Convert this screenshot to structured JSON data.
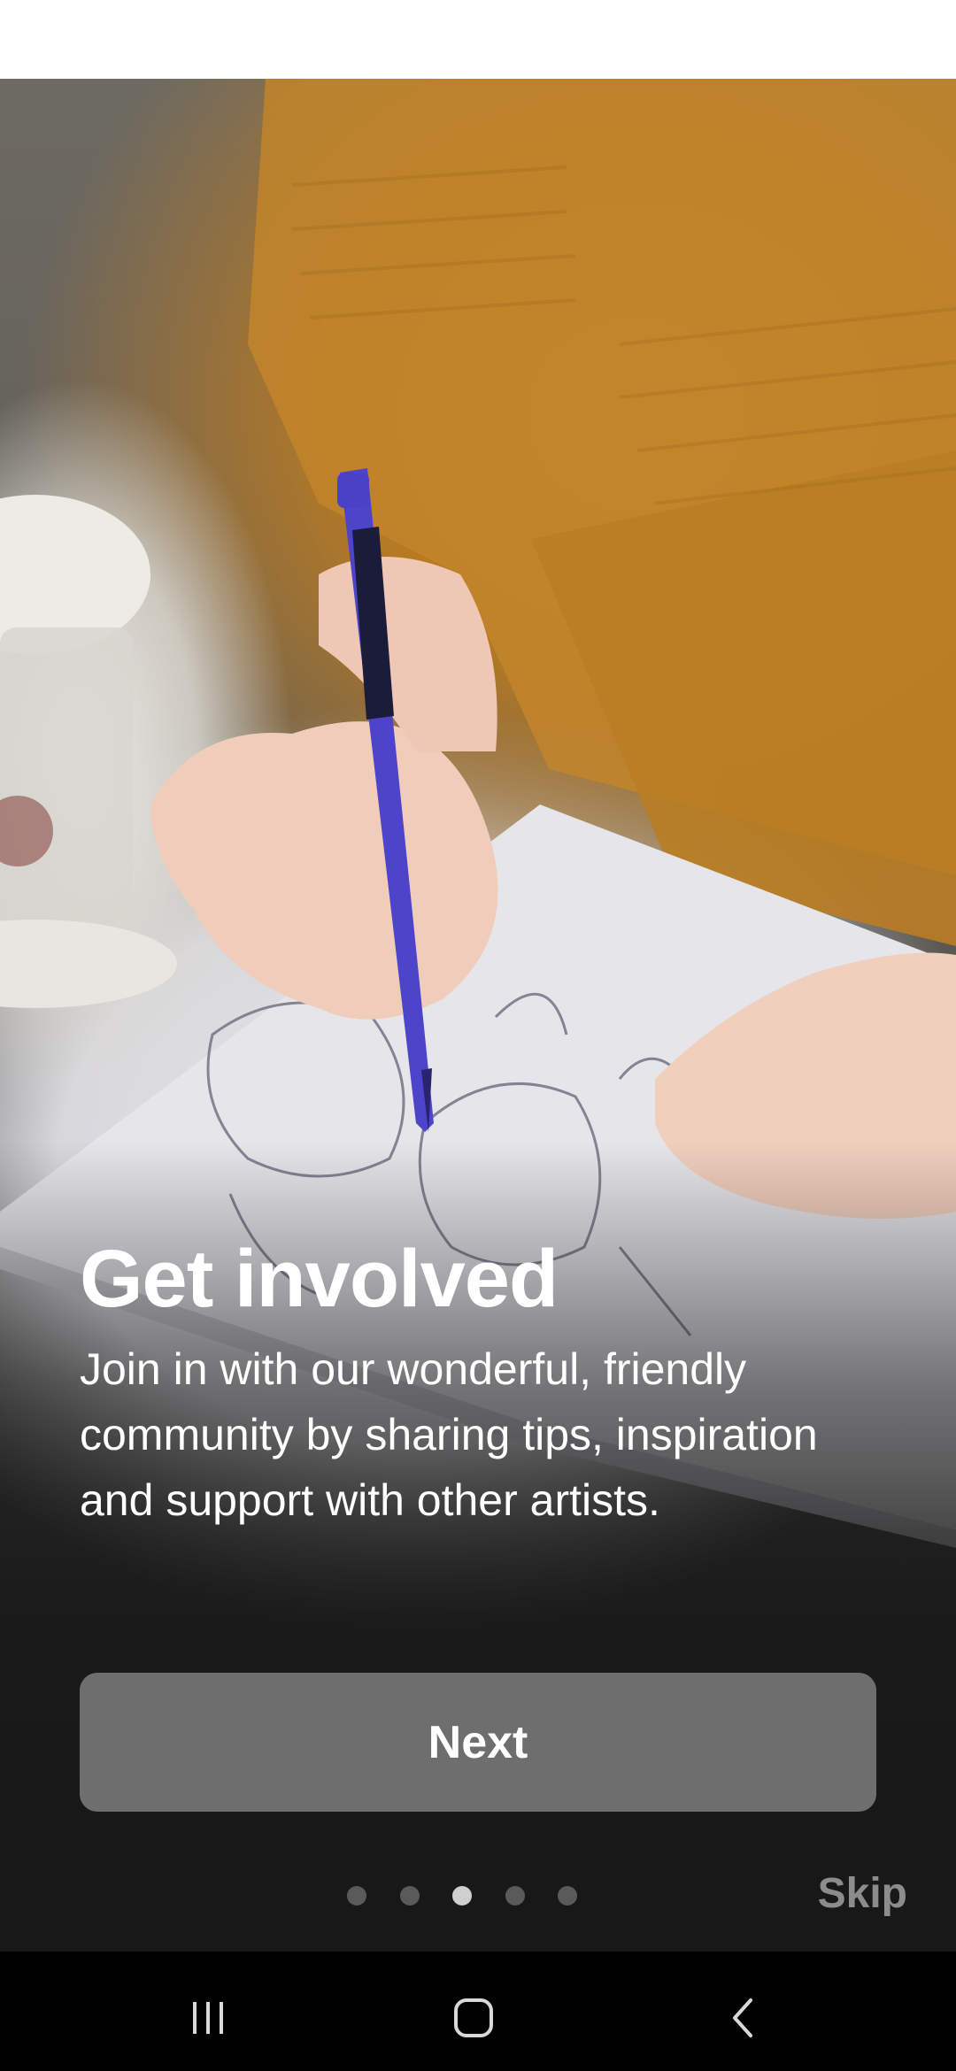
{
  "onboarding": {
    "title": "Get involved",
    "body": "Join in with our wonderful, friendly community by sharing tips, inspiration and support with other artists.",
    "next_label": "Next",
    "skip_label": "Skip",
    "page_count": 5,
    "current_page": 3
  },
  "hero_image": {
    "subject": "hands drawing a sketch with a blue mechanical pencil"
  },
  "nav": {
    "recents_icon": "recents-icon",
    "home_icon": "home-icon",
    "back_icon": "back-icon"
  },
  "colors": {
    "button_bg": "#6e6e6e",
    "dot_active": "#cfcfcf",
    "dot_inactive": "#5a5a5a",
    "skip_text": "#8c8c8c"
  }
}
